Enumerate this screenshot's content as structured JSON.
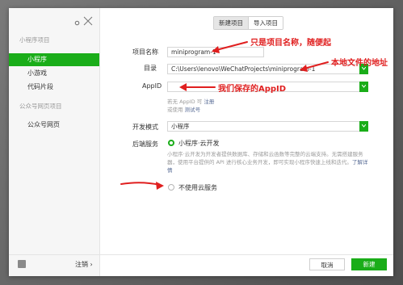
{
  "sidebar": {
    "sections": [
      {
        "title": "小程序项目",
        "items": [
          "小程序",
          "小游戏",
          "代码片段"
        ]
      },
      {
        "title": "公众号网页项目",
        "items": [
          "公众号网页"
        ]
      }
    ],
    "logout_label": "注销"
  },
  "tabs": [
    "新建项目",
    "导入项目"
  ],
  "form": {
    "project_name_label": "项目名称",
    "project_name_value": "miniprogram-1",
    "dir_label": "目录",
    "dir_value": "C:\\Users\\lenovo\\WeChatProjects\\miniprogram-1",
    "appid_label": "AppID",
    "appid_value": "",
    "appid_hint_1": "若无 AppID 可",
    "appid_hint_register": "注册",
    "appid_hint_2": "或使用",
    "appid_hint_test": "测试号",
    "dev_mode_label": "开发模式",
    "dev_mode_value": "小程序",
    "backend_label": "后端服务",
    "cloud_option": "小程序·云开发",
    "cloud_desc": "小程序·云开发为开发者提供数据库、存储和云函数等完整的云端支持。无需搭建服务器，使用平台提供的 API 进行核心业务开发，即可实现小程序快速上线和迭代。",
    "cloud_desc_link": "了解详情",
    "no_cloud_option": "不使用云服务"
  },
  "buttons": {
    "cancel": "取消",
    "create": "新建"
  },
  "annotations": {
    "name_note": "只是项目名称，随便起",
    "dir_note": "本地文件的地址",
    "appid_note": "我们保存的AppID"
  },
  "colors": {
    "accent": "#1aad19",
    "annotation": "#e01f1f",
    "link": "#576b95"
  }
}
